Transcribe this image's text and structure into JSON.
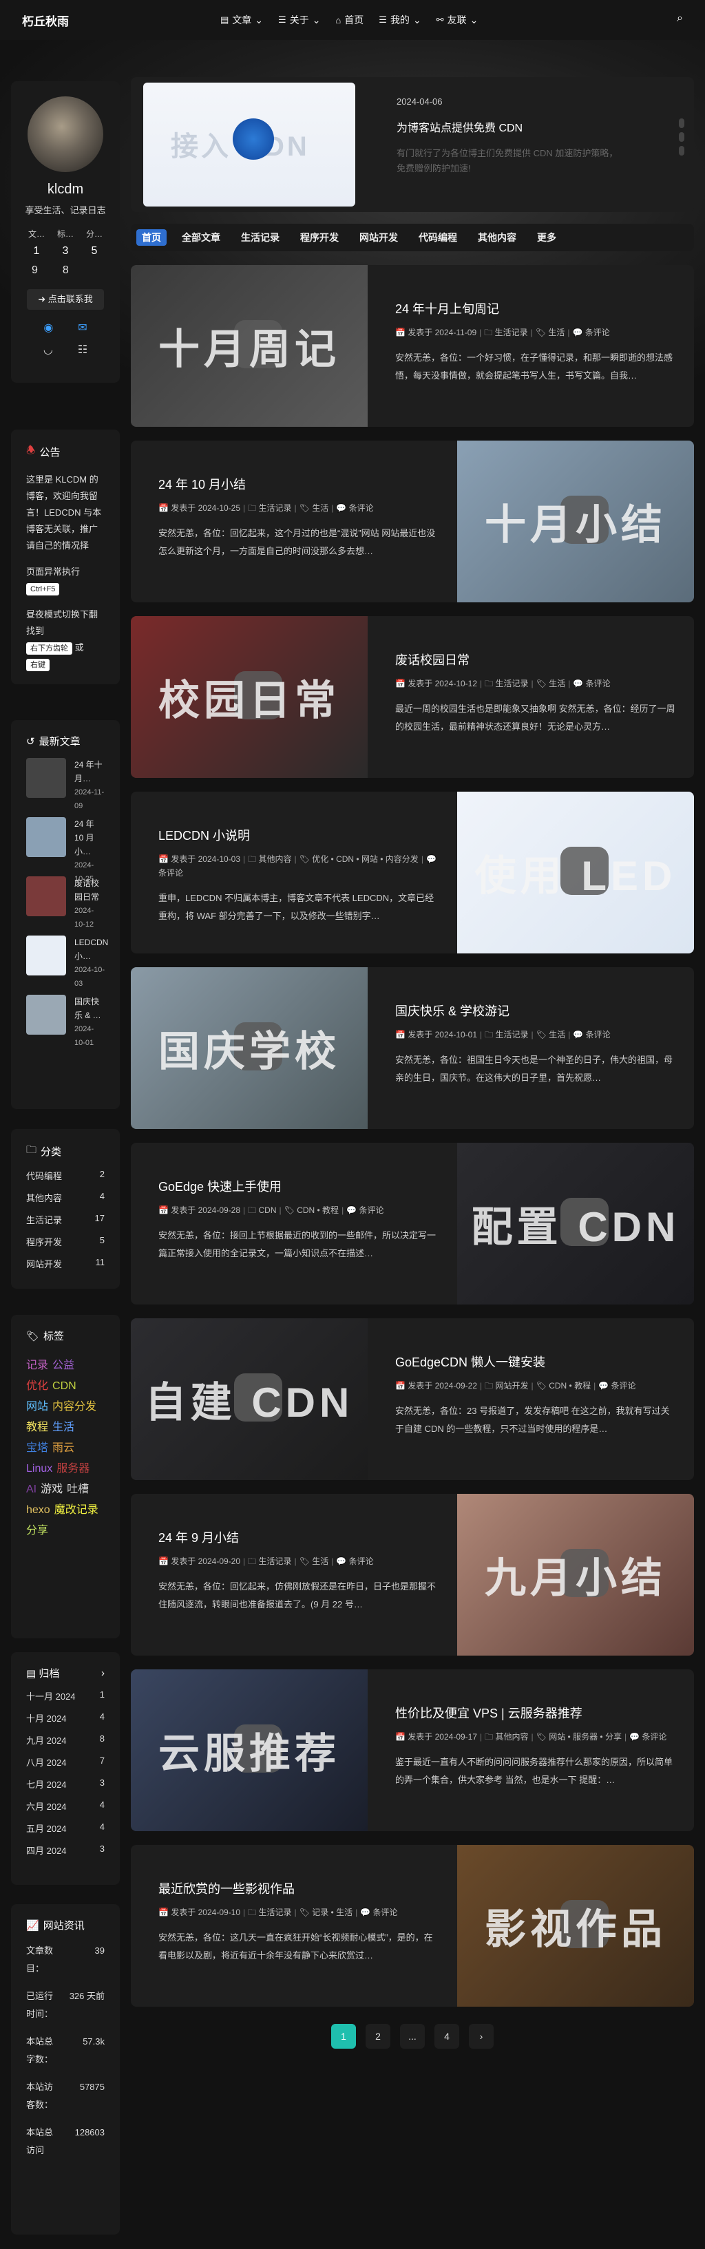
{
  "site": {
    "title": "朽丘秋雨"
  },
  "nav": [
    {
      "icon": "▤",
      "label": "文章",
      "caret": "⌄"
    },
    {
      "icon": "☰",
      "label": "关于",
      "caret": "⌄"
    },
    {
      "icon": "⌂",
      "label": "首页",
      "caret": ""
    },
    {
      "icon": "☰",
      "label": "我的",
      "caret": "⌄"
    },
    {
      "icon": "⚯",
      "label": "友联",
      "caret": "⌄"
    }
  ],
  "profile": {
    "name": "klcdm",
    "bio": "享受生活、记录日志",
    "stat_labels": [
      "文…",
      "标…",
      "分…"
    ],
    "stat_values": [
      "1",
      "3",
      "5"
    ],
    "stat_values2": [
      "9",
      "8"
    ],
    "contact": "点击联系我"
  },
  "notice": {
    "title": "公告",
    "text": "这里是 KLCDM 的博客，欢迎向我留言！LEDCDN 与本博客无关联，推广请自己的情况择",
    "line2": "页面异常执行",
    "kbd1": "Ctrl+F5",
    "line3": "昼夜模式切换下翻找到",
    "kbd2": "右下方齿轮",
    "line4": "或",
    "kbd3": "右键"
  },
  "recent": {
    "title": "最新文章",
    "items": [
      {
        "title": "24 年十月…",
        "date": "2024-11-09",
        "color": "#444"
      },
      {
        "title": "24 年 10 月小…",
        "date": "2024-10-25",
        "color": "#8aa0b4"
      },
      {
        "title": "废话校园日常",
        "date": "2024-10-12",
        "color": "#7a3a3a"
      },
      {
        "title": "LEDCDN 小…",
        "date": "2024-10-03",
        "color": "#e8eef6"
      },
      {
        "title": "国庆快乐 & …",
        "date": "2024-10-01",
        "color": "#9aa8b4"
      }
    ]
  },
  "categories": {
    "title": "分类",
    "items": [
      {
        "name": "代码编程",
        "count": "2"
      },
      {
        "name": "其他内容",
        "count": "4"
      },
      {
        "name": "生活记录",
        "count": "17"
      },
      {
        "name": "程序开发",
        "count": "5"
      },
      {
        "name": "网站开发",
        "count": "11"
      }
    ]
  },
  "tags": {
    "title": "标签",
    "items": [
      {
        "name": "记录",
        "color": "#c060c0"
      },
      {
        "name": "公益",
        "color": "#a060d0"
      },
      {
        "name": "优化",
        "color": "#e04040"
      },
      {
        "name": "CDN",
        "color": "#c0d040"
      },
      {
        "name": "网站",
        "color": "#60c0ff"
      },
      {
        "name": "内容分发",
        "color": "#e0c040"
      },
      {
        "name": "教程",
        "color": "#f0e060"
      },
      {
        "name": "生活",
        "color": "#60a0ff"
      },
      {
        "name": "宝塔",
        "color": "#4080e0"
      },
      {
        "name": "雨云",
        "color": "#e0a040"
      },
      {
        "name": "Linux",
        "color": "#a060e0"
      },
      {
        "name": "服务器",
        "color": "#c04040"
      },
      {
        "name": "AI",
        "color": "#8040a0"
      },
      {
        "name": "游戏",
        "color": "#e0e0e0"
      },
      {
        "name": "吐槽",
        "color": "#d0d0d0"
      },
      {
        "name": "hexo",
        "color": "#e0c060"
      },
      {
        "name": "魔改记录",
        "color": "#f0f040"
      },
      {
        "name": "分享",
        "color": "#c0e060"
      }
    ]
  },
  "archive": {
    "title": "归档",
    "items": [
      {
        "month": "十一月 2024",
        "count": "1"
      },
      {
        "month": "十月 2024",
        "count": "4"
      },
      {
        "month": "九月 2024",
        "count": "8"
      },
      {
        "month": "八月 2024",
        "count": "7"
      },
      {
        "month": "七月 2024",
        "count": "3"
      },
      {
        "month": "六月 2024",
        "count": "4"
      },
      {
        "month": "五月 2024",
        "count": "4"
      },
      {
        "month": "四月 2024",
        "count": "3"
      }
    ]
  },
  "siteinfo": {
    "title": "网站资讯",
    "rows": [
      {
        "k": "文章数目：",
        "v": "39"
      },
      {
        "k": "已运行时间：",
        "v": "326 天前"
      },
      {
        "k": "本站总字数：",
        "v": "57.3k"
      },
      {
        "k": "本站访客数：",
        "v": "57875"
      },
      {
        "k": "本站总访问",
        "v": "128603"
      }
    ]
  },
  "featured": {
    "date": "2024-04-06",
    "title": "为博客站点提供免费 CDN",
    "desc": "有门就行了为各位博主们免费提供 CDN 加速防护策略，免费赠例防护加速!",
    "img_text": "接入 CDN"
  },
  "tabs": [
    "首页",
    "全部文章",
    "生活记录",
    "程序开发",
    "网站开发",
    "代码编程",
    "其他内容",
    "更多"
  ],
  "posts": [
    {
      "title": "24 年十月上旬周记",
      "date": "2024-11-09",
      "cat": "生活记录",
      "tags": "生活",
      "comments": "条评论",
      "excerpt": "安然无恙，各位：一个好习惯，在子懂得记录，和那一瞬即逝的想法感悟，每天没事情做，就会提起笔书写人生，书写文篇。自我…",
      "img_text": "十月周记",
      "color1": "#3a3a3a",
      "color2": "#5a5a5a"
    },
    {
      "title": "24 年 10 月小结",
      "date": "2024-10-25",
      "cat": "生活记录",
      "tags": "生活",
      "comments": "条评论",
      "excerpt": "安然无恙，各位：回忆起来，这个月过的也是“混说”网站 网站最近也没怎么更新这个月，一方面是自己的时间没那么多去想…",
      "img_text": "十月小结",
      "color1": "#8aa0b4",
      "color2": "#5b6c7a"
    },
    {
      "title": "废话校园日常",
      "date": "2024-10-12",
      "cat": "生活记录",
      "tags": "生活",
      "comments": "条评论",
      "excerpt": "最近一周的校园生活也是即能象又抽象啊 安然无恙，各位：经历了一周的校园生活，最前精神状态还算良好！无论是心灵方…",
      "img_text": "校园日常",
      "color1": "#7a2a2a",
      "color2": "#2a2a2a"
    },
    {
      "title": "LEDCDN 小说明",
      "date": "2024-10-03",
      "cat": "其他内容",
      "tags": "优化 • CDN • 网站 • 内容分发",
      "comments": "条评论",
      "excerpt": "重申，LEDCDN 不归属本博主，博客文章不代表 LEDCDN，文章已经重构，将 WAF 部分完善了一下，以及修改一些错别字…",
      "img_text": "使用 LED",
      "color1": "#f0f4fa",
      "color2": "#dce6f2"
    },
    {
      "title": "国庆快乐 & 学校游记",
      "date": "2024-10-01",
      "cat": "生活记录",
      "tags": "生活",
      "comments": "条评论",
      "excerpt": "安然无恙，各位：祖国生日今天也是一个神圣的日子，伟大的祖国，母亲的生日，国庆节。在这伟大的日子里，首先祝愿…",
      "img_text": "国庆学校",
      "color1": "#8a9aa6",
      "color2": "#4e5a5e"
    },
    {
      "title": "GoEdge 快速上手使用",
      "date": "2024-09-28",
      "cat": "CDN",
      "tags": "CDN • 教程",
      "comments": "条评论",
      "excerpt": "安然无恙，各位：接回上节根据最近的收到的一些邮件，所以决定写一篇正常接入使用的全记录文，一篇小知识点不在描述…",
      "img_text": "配置 CDN",
      "color1": "#2a2a2e",
      "color2": "#1a1a1e"
    },
    {
      "title": "GoEdgeCDN 懒人一键安装",
      "date": "2024-09-22",
      "cat": "网站开发",
      "tags": "CDN • 教程",
      "comments": "条评论",
      "excerpt": "安然无恙，各位：23 号报道了，发发存稿吧 在这之前，我就有写过关于自建 CDN 的一些教程，只不过当时使用的程序是…",
      "img_text": "自建 CDN",
      "color1": "#2c2c30",
      "color2": "#1c1c1c"
    },
    {
      "title": "24 年 9 月小结",
      "date": "2024-09-20",
      "cat": "生活记录",
      "tags": "生活",
      "comments": "条评论",
      "excerpt": "安然无恙，各位：回忆起来，仿佛刚放假还是在昨日，日子也是那握不住随风逐流，转眼间也准备报道去了。(9 月 22 号…",
      "img_text": "九月小结",
      "color1": "#b08878",
      "color2": "#5a3a34"
    },
    {
      "title": "性价比及便宜 VPS | 云服务器推荐",
      "date": "2024-09-17",
      "cat": "其他内容",
      "tags": "网站 • 服务器 • 分享",
      "comments": "条评论",
      "excerpt": "鉴于最近一直有人不断的问问问服务器推荐什么那家的原因，所以简单的弄一个集合，供大家参考 当然，也是水一下 提醒：…",
      "img_text": "云服推荐",
      "color1": "#3a4660",
      "color2": "#1a1e2a"
    },
    {
      "title": "最近欣赏的一些影视作品",
      "date": "2024-09-10",
      "cat": "生活记录",
      "tags": "记录 • 生活",
      "comments": "条评论",
      "excerpt": "安然无恙，各位：这几天一直在疯狂开始“长视频耐心模式”，是的，在看电影以及剧，将近有近十余年没有静下心来欣赏过…",
      "img_text": "影视作品",
      "color1": "#6a4a2a",
      "color2": "#3a2a1a"
    }
  ],
  "pager": [
    "1",
    "2",
    "...",
    "4",
    "›"
  ],
  "meta_labels": {
    "published": "发表于"
  }
}
